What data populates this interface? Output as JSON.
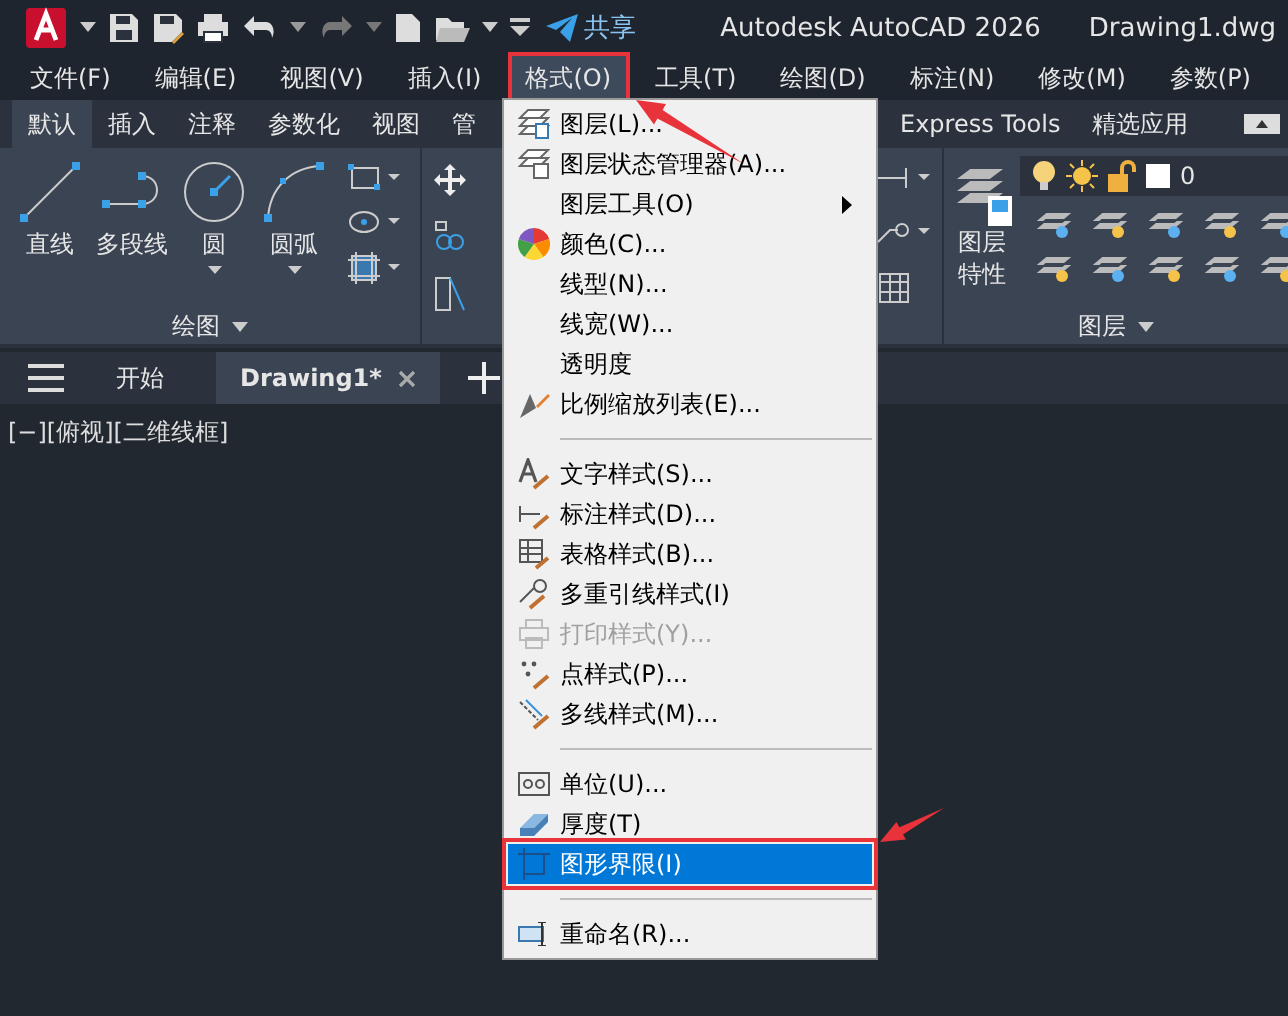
{
  "title_bar": {
    "share": "共享",
    "app_title": "Autodesk AutoCAD 2026",
    "file_name": "Drawing1.dwg"
  },
  "menu_bar": [
    {
      "label": "文件(F)",
      "open": false
    },
    {
      "label": "编辑(E)",
      "open": false
    },
    {
      "label": "视图(V)",
      "open": false
    },
    {
      "label": "插入(I)",
      "open": false
    },
    {
      "label": "格式(O)",
      "open": true
    },
    {
      "label": "工具(T)",
      "open": false
    },
    {
      "label": "绘图(D)",
      "open": false
    },
    {
      "label": "标注(N)",
      "open": false
    },
    {
      "label": "修改(M)",
      "open": false
    },
    {
      "label": "参数(P)",
      "open": false
    }
  ],
  "ribbon_tabs": [
    {
      "label": "默认",
      "selected": true
    },
    {
      "label": "插入",
      "selected": false
    },
    {
      "label": "注释",
      "selected": false
    },
    {
      "label": "参数化",
      "selected": false
    },
    {
      "label": "视图",
      "selected": false
    },
    {
      "label": "管",
      "selected": false
    },
    {
      "label": "Express Tools",
      "selected": false
    },
    {
      "label": "精选应用",
      "selected": false
    }
  ],
  "draw_panel": {
    "title": "绘图",
    "tools": [
      {
        "label": "直线",
        "kind": "line",
        "dropdown": false
      },
      {
        "label": "多段线",
        "kind": "polyline",
        "dropdown": false
      },
      {
        "label": "圆",
        "kind": "circle",
        "dropdown": true
      },
      {
        "label": "圆弧",
        "kind": "arc",
        "dropdown": true
      }
    ]
  },
  "layers_panel": {
    "title": "图层",
    "properties_label": "图层特性",
    "current_layer": "0"
  },
  "file_tabs": [
    {
      "label": "开始",
      "selected": false,
      "closable": false
    },
    {
      "label": "Drawing1*",
      "selected": true,
      "closable": true
    }
  ],
  "viewport_label": "[−][俯视][二维线框]",
  "format_menu": {
    "items": [
      {
        "kind": "item",
        "label": "图层(L)...",
        "disabled": false,
        "selected": false,
        "submenu": false
      },
      {
        "kind": "item",
        "label": "图层状态管理器(A)...",
        "disabled": false,
        "selected": false,
        "submenu": false
      },
      {
        "kind": "item",
        "label": "图层工具(O)",
        "disabled": false,
        "selected": false,
        "submenu": true
      },
      {
        "kind": "item",
        "label": "颜色(C)...",
        "disabled": false,
        "selected": false,
        "submenu": false
      },
      {
        "kind": "item",
        "label": "线型(N)...",
        "disabled": false,
        "selected": false,
        "submenu": false
      },
      {
        "kind": "item",
        "label": "线宽(W)...",
        "disabled": false,
        "selected": false,
        "submenu": false
      },
      {
        "kind": "item",
        "label": "透明度",
        "disabled": false,
        "selected": false,
        "submenu": false
      },
      {
        "kind": "item",
        "label": "比例缩放列表(E)...",
        "disabled": false,
        "selected": false,
        "submenu": false
      },
      {
        "kind": "separator"
      },
      {
        "kind": "item",
        "label": "文字样式(S)...",
        "disabled": false,
        "selected": false,
        "submenu": false
      },
      {
        "kind": "item",
        "label": "标注样式(D)...",
        "disabled": false,
        "selected": false,
        "submenu": false
      },
      {
        "kind": "item",
        "label": "表格样式(B)...",
        "disabled": false,
        "selected": false,
        "submenu": false
      },
      {
        "kind": "item",
        "label": "多重引线样式(I)",
        "disabled": false,
        "selected": false,
        "submenu": false
      },
      {
        "kind": "item",
        "label": "打印样式(Y)...",
        "disabled": true,
        "selected": false,
        "submenu": false
      },
      {
        "kind": "item",
        "label": "点样式(P)...",
        "disabled": false,
        "selected": false,
        "submenu": false
      },
      {
        "kind": "item",
        "label": "多线样式(M)...",
        "disabled": false,
        "selected": false,
        "submenu": false
      },
      {
        "kind": "separator"
      },
      {
        "kind": "item",
        "label": "单位(U)...",
        "disabled": false,
        "selected": false,
        "submenu": false
      },
      {
        "kind": "item",
        "label": "厚度(T)",
        "disabled": false,
        "selected": false,
        "submenu": false
      },
      {
        "kind": "item",
        "label": "图形界限(I)",
        "disabled": false,
        "selected": true,
        "submenu": false
      },
      {
        "kind": "separator"
      },
      {
        "kind": "item",
        "label": "重命名(R)...",
        "disabled": false,
        "selected": false,
        "submenu": false
      }
    ]
  }
}
